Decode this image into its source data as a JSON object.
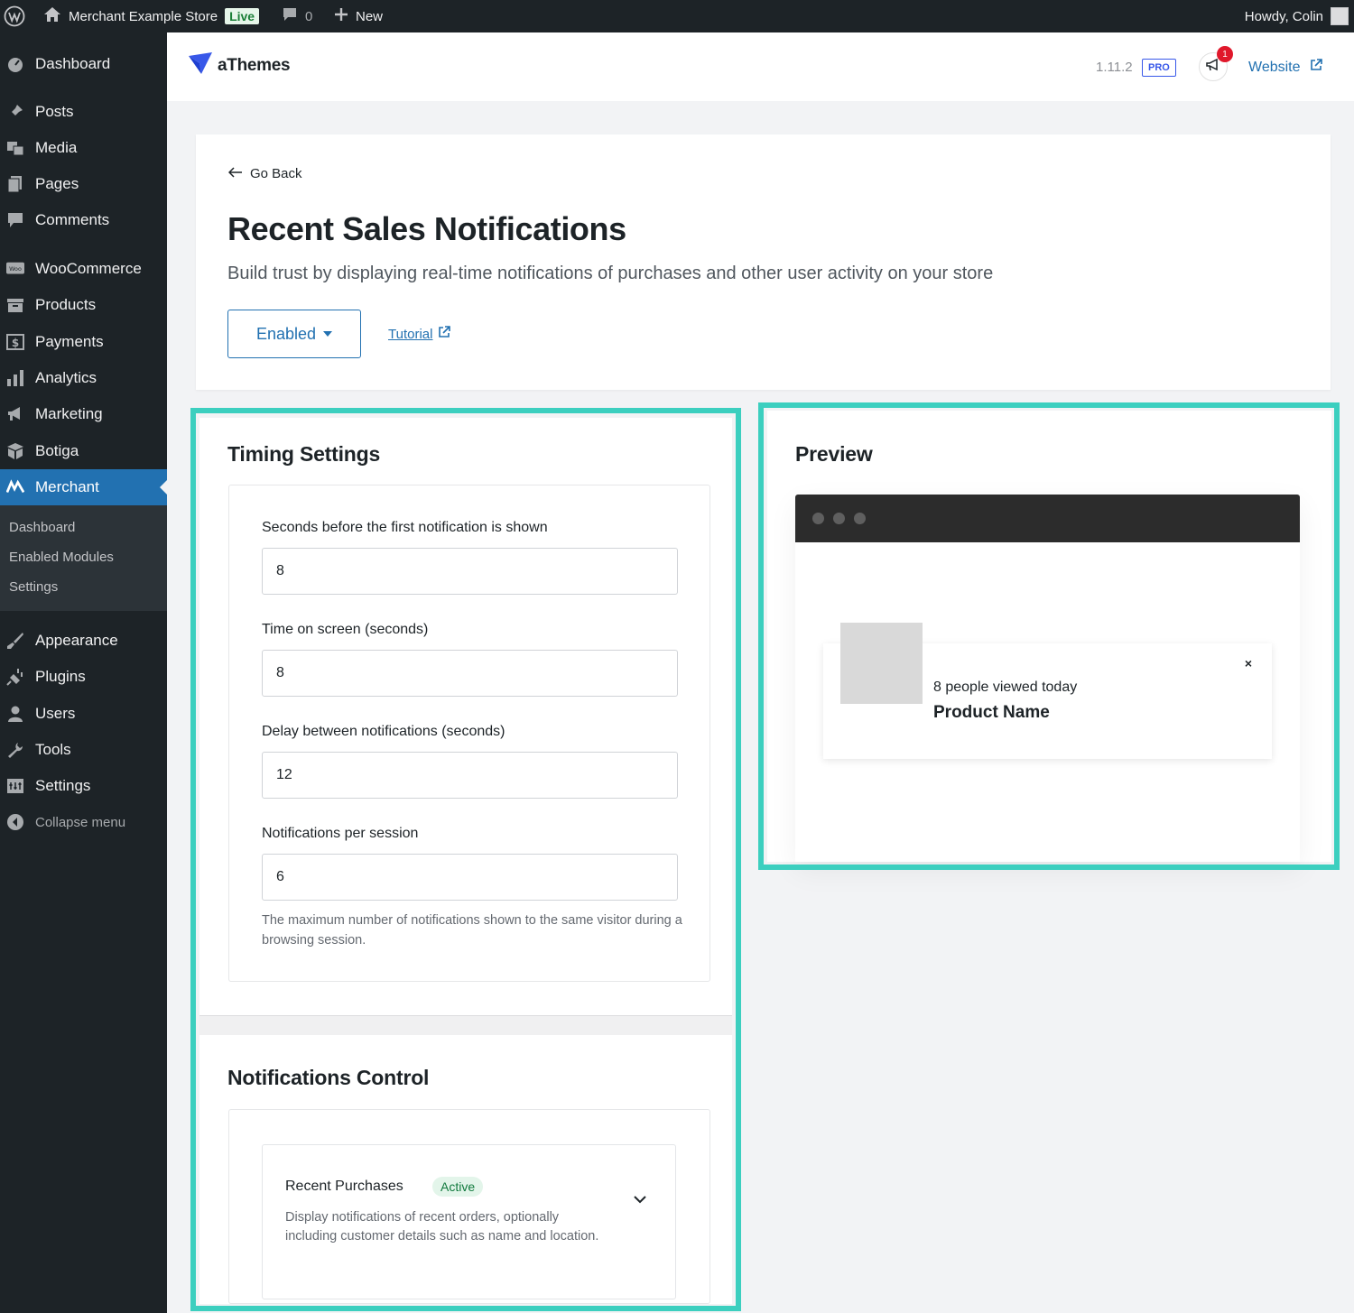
{
  "adminbar": {
    "site_name": "Merchant Example Store",
    "live_badge": "Live",
    "comments_count": "0",
    "new_label": "New",
    "howdy": "Howdy, Colin"
  },
  "sidebar": {
    "items": [
      {
        "label": "Dashboard",
        "icon": "dashboard-icon"
      },
      {
        "label": "Posts",
        "icon": "pin-icon"
      },
      {
        "label": "Media",
        "icon": "media-icon"
      },
      {
        "label": "Pages",
        "icon": "pages-icon"
      },
      {
        "label": "Comments",
        "icon": "comment-icon"
      },
      {
        "label": "WooCommerce",
        "icon": "woo-icon"
      },
      {
        "label": "Products",
        "icon": "archive-icon"
      },
      {
        "label": "Payments",
        "icon": "dollar-icon"
      },
      {
        "label": "Analytics",
        "icon": "bar-chart-icon"
      },
      {
        "label": "Marketing",
        "icon": "megaphone-icon"
      },
      {
        "label": "Botiga",
        "icon": "box-icon"
      },
      {
        "label": "Merchant",
        "icon": "merchant-icon",
        "active": true
      },
      {
        "label": "Appearance",
        "icon": "brush-icon"
      },
      {
        "label": "Plugins",
        "icon": "plug-icon"
      },
      {
        "label": "Users",
        "icon": "user-icon"
      },
      {
        "label": "Tools",
        "icon": "wrench-icon"
      },
      {
        "label": "Settings",
        "icon": "settings-icon"
      }
    ],
    "submenu": [
      "Dashboard",
      "Enabled Modules",
      "Settings"
    ],
    "collapse_label": "Collapse menu"
  },
  "plugin_header": {
    "brand": "aThemes",
    "version": "1.11.2",
    "pro_badge": "PRO",
    "notification_count": "1",
    "website_label": "Website"
  },
  "module": {
    "go_back": "Go Back",
    "title": "Recent Sales Notifications",
    "description": "Build trust by displaying real-time notifications of purchases and other user activity on your store",
    "status": "Enabled",
    "tutorial": "Tutorial"
  },
  "timing": {
    "title": "Timing Settings",
    "fields": [
      {
        "label": "Seconds before the first notification is shown",
        "value": "8"
      },
      {
        "label": "Time on screen (seconds)",
        "value": "8"
      },
      {
        "label": "Delay between notifications (seconds)",
        "value": "12"
      },
      {
        "label": "Notifications per session",
        "value": "6"
      }
    ],
    "help": "The maximum number of notifications shown to the same visitor during a browsing session."
  },
  "control": {
    "title": "Notifications Control",
    "module_title": "Recent Purchases",
    "module_status": "Active",
    "module_desc": "Display notifications of recent orders, optionally including customer details such as name and location."
  },
  "preview": {
    "title": "Preview",
    "line": "8 people viewed today",
    "product": "Product Name",
    "close": "×"
  },
  "colors": {
    "highlight": "#3ccfbf",
    "accent": "#2271b1",
    "sidebar_bg": "#1d2327",
    "active_bg": "#2271b1"
  }
}
